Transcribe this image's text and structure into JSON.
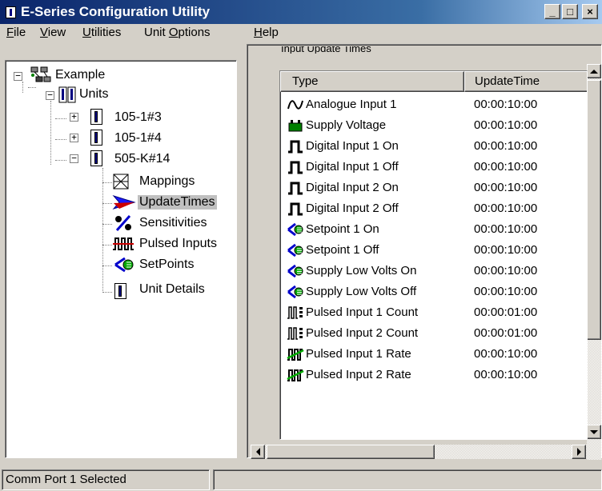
{
  "window": {
    "title": "E-Series Configuration Utility",
    "controls": {
      "minimize": "_",
      "maximize": "□",
      "close": "×"
    }
  },
  "menu": [
    {
      "mnemonic": "F",
      "rest": "ile"
    },
    {
      "mnemonic": "V",
      "rest": "iew"
    },
    {
      "mnemonic": "U",
      "rest": "tilities"
    },
    {
      "prefix": "Unit ",
      "mnemonic": "O",
      "rest": "ptions"
    },
    {
      "mnemonic": "H",
      "rest": "elp"
    }
  ],
  "tree": {
    "root": {
      "label": "Example",
      "icon": "network-icon",
      "expander": "−"
    },
    "units": {
      "label": "Units",
      "icon": "units-icon",
      "expander": "−"
    },
    "unit_nodes": [
      {
        "label": "105-1#3",
        "expander": "+"
      },
      {
        "label": "105-1#4",
        "expander": "+"
      },
      {
        "label": "505-K#14",
        "expander": "−"
      }
    ],
    "children": [
      {
        "label": "Mappings",
        "icon": "mappings-icon",
        "selected": false
      },
      {
        "label": "UpdateTimes",
        "icon": "update-times-arrow-icon",
        "selected": true
      },
      {
        "label": "Sensitivities",
        "icon": "percent-icon",
        "selected": false
      },
      {
        "label": "Pulsed Inputs",
        "icon": "pulsed-inputs-icon",
        "selected": false
      },
      {
        "label": "SetPoints",
        "icon": "setpoint-icon",
        "selected": false
      },
      {
        "label": "Unit Details",
        "icon": "unit-details-icon",
        "selected": false
      }
    ]
  },
  "group_box": {
    "label": "Input Update Times"
  },
  "list": {
    "columns": {
      "type": "Type",
      "update_time": "UpdateTime"
    },
    "rows": [
      {
        "type": "Analogue Input 1",
        "time": "00:00:10:00",
        "icon": "analogue-wave-icon"
      },
      {
        "type": "Supply Voltage",
        "time": "00:00:10:00",
        "icon": "battery-icon"
      },
      {
        "type": "Digital Input 1 On",
        "time": "00:00:10:00",
        "icon": "digital-pulse-icon"
      },
      {
        "type": "Digital Input 1 Off",
        "time": "00:00:10:00",
        "icon": "digital-pulse-icon"
      },
      {
        "type": "Digital Input 2 On",
        "time": "00:00:10:00",
        "icon": "digital-pulse-icon"
      },
      {
        "type": "Digital Input 2 Off",
        "time": "00:00:10:00",
        "icon": "digital-pulse-icon"
      },
      {
        "type": "Setpoint 1 On",
        "time": "00:00:10:00",
        "icon": "setpoint-icon"
      },
      {
        "type": "Setpoint 1 Off",
        "time": "00:00:10:00",
        "icon": "setpoint-icon"
      },
      {
        "type": "Supply Low Volts On",
        "time": "00:00:10:00",
        "icon": "setpoint-icon"
      },
      {
        "type": "Supply Low Volts Off",
        "time": "00:00:10:00",
        "icon": "setpoint-icon"
      },
      {
        "type": "Pulsed Input 1 Count",
        "time": "00:00:01:00",
        "icon": "pulse-count-icon"
      },
      {
        "type": "Pulsed Input 2 Count",
        "time": "00:00:01:00",
        "icon": "pulse-count-icon"
      },
      {
        "type": "Pulsed Input 1 Rate",
        "time": "00:00:10:00",
        "icon": "pulse-rate-icon"
      },
      {
        "type": "Pulsed Input 2 Rate",
        "time": "00:00:10:00",
        "icon": "pulse-rate-icon"
      }
    ]
  },
  "status": {
    "text": "Comm Port 1 Selected"
  },
  "colors": {
    "titlebar_start": "#0a246a",
    "titlebar_end": "#a6caf0",
    "face": "#d4d0c8",
    "selection": "#c0c0c0",
    "icon_blue": "#0000cc",
    "icon_red": "#cc0000",
    "icon_green": "#008000"
  }
}
